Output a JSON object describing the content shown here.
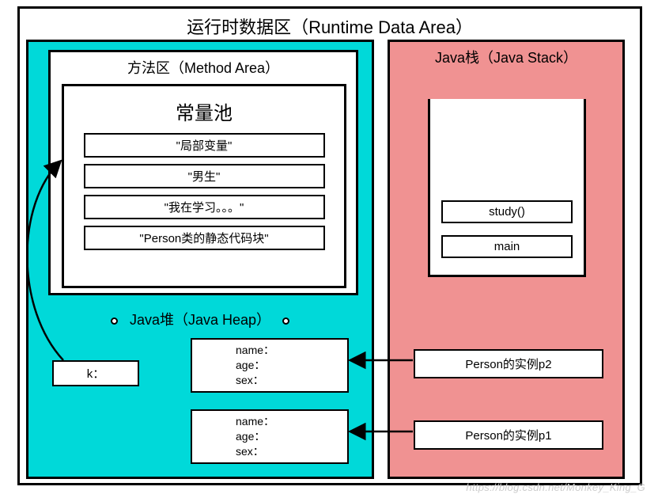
{
  "title": "运行时数据区（Runtime Data Area）",
  "methodArea": {
    "title": "方法区（Method Area）",
    "constPool": {
      "title": "常量池",
      "items": [
        "\"局部变量\"",
        "\"男生\"",
        "\"我在学习。。。\"",
        "\"Person类的静态代码块\""
      ]
    }
  },
  "heap": {
    "title": "Java堆（Java Heap）",
    "k": "k：",
    "obj": {
      "name": "name：",
      "age": "age：",
      "sex": "sex："
    }
  },
  "stack": {
    "title": "Java栈（Java Stack）",
    "frames": [
      "study()",
      "main"
    ],
    "instances": [
      "Person的实例p2",
      "Person的实例p1"
    ]
  },
  "watermark": "https://blog.csdn.net/Monkey_King_G"
}
